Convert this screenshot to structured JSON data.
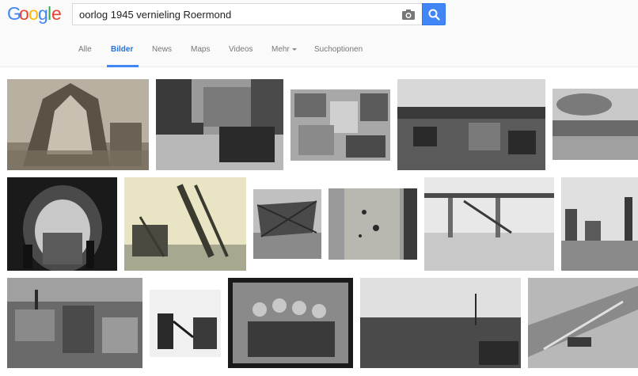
{
  "logo": {
    "text": "Google"
  },
  "search": {
    "query": "oorlog 1945 vernieling Roermond"
  },
  "tabs": [
    {
      "label": "Alle"
    },
    {
      "label": "Bilder"
    },
    {
      "label": "News"
    },
    {
      "label": "Maps"
    },
    {
      "label": "Videos"
    },
    {
      "label": "Mehr"
    },
    {
      "label": "Suchoptionen"
    }
  ],
  "colors": {
    "accent": "#4285f4",
    "tab_active": "#1a73e8",
    "tab_inactive": "#777777"
  },
  "icons": {
    "camera": "camera-icon",
    "search": "search-icon"
  }
}
